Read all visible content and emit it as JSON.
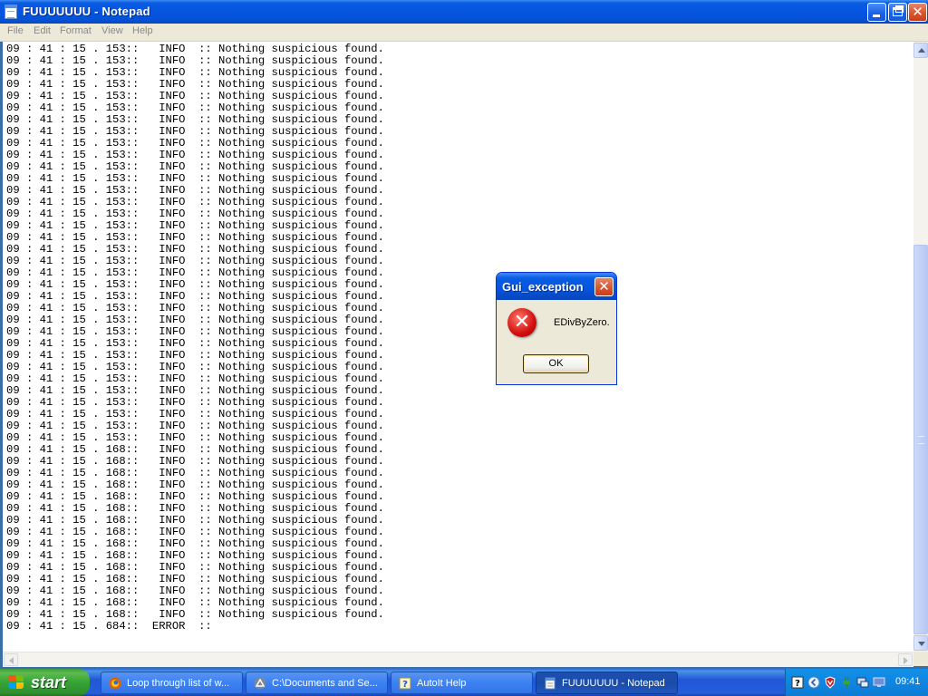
{
  "window": {
    "title": "FUUUUUUU - Notepad"
  },
  "menu": [
    "File",
    "Edit",
    "Format",
    "View",
    "Help"
  ],
  "log": {
    "lines_153": {
      "count": 34,
      "text": "09 : 41 : 15 . 153::   INFO  :: Nothing suspicious found."
    },
    "lines_168": {
      "count": 15,
      "text": "09 : 41 : 15 . 168::   INFO  :: Nothing suspicious found."
    },
    "last_line": "09 : 41 : 15 . 684::  ERROR  ::"
  },
  "dialog": {
    "title": "Gui_exception",
    "message": "EDivByZero.",
    "ok_label": "OK",
    "close_glyph": "✕",
    "error_glyph": "✕"
  },
  "taskbar": {
    "start_label": "start",
    "tasks": [
      {
        "label": "Loop through list of w...",
        "icon": "firefox-icon"
      },
      {
        "label": "C:\\Documents and Se...",
        "icon": "autoit-script-icon"
      },
      {
        "label": "AutoIt Help",
        "icon": "help-icon"
      },
      {
        "label": "FUUUUUUU - Notepad",
        "icon": "notepad-icon"
      }
    ],
    "clock": "09:41"
  },
  "colors": {
    "titlebar": "#0554e0",
    "taskbar": "#245edb",
    "start_green": "#36a336",
    "tray": "#0f86e0",
    "error_red": "#d10f0f"
  }
}
